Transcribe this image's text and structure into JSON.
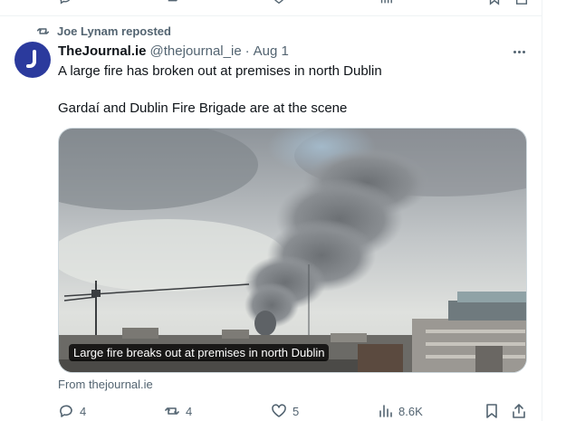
{
  "repost": {
    "label": "Joe Lynam reposted"
  },
  "tweet": {
    "author_name": "TheJournal.ie",
    "author_handle": "@thejournal_ie",
    "separator": "·",
    "date": "Aug 1",
    "line1": "A large fire has broken out at premises in north Dublin",
    "line2": "Gardaí and Dublin Fire Brigade are at the scene",
    "media_caption": "Large fire breaks out at premises in north Dublin",
    "source": "From thejournal.ie"
  },
  "actions": {
    "replies": "4",
    "reposts": "4",
    "likes": "5",
    "views": "8.6K"
  },
  "colors": {
    "text": "#0f1419",
    "secondary": "#536471",
    "avatar_bg": "#2b3a9d",
    "border": "#eff3f4"
  },
  "icons": [
    "repost-icon",
    "more-icon",
    "reply-icon",
    "like-icon",
    "views-icon",
    "bookmark-icon",
    "share-icon"
  ]
}
